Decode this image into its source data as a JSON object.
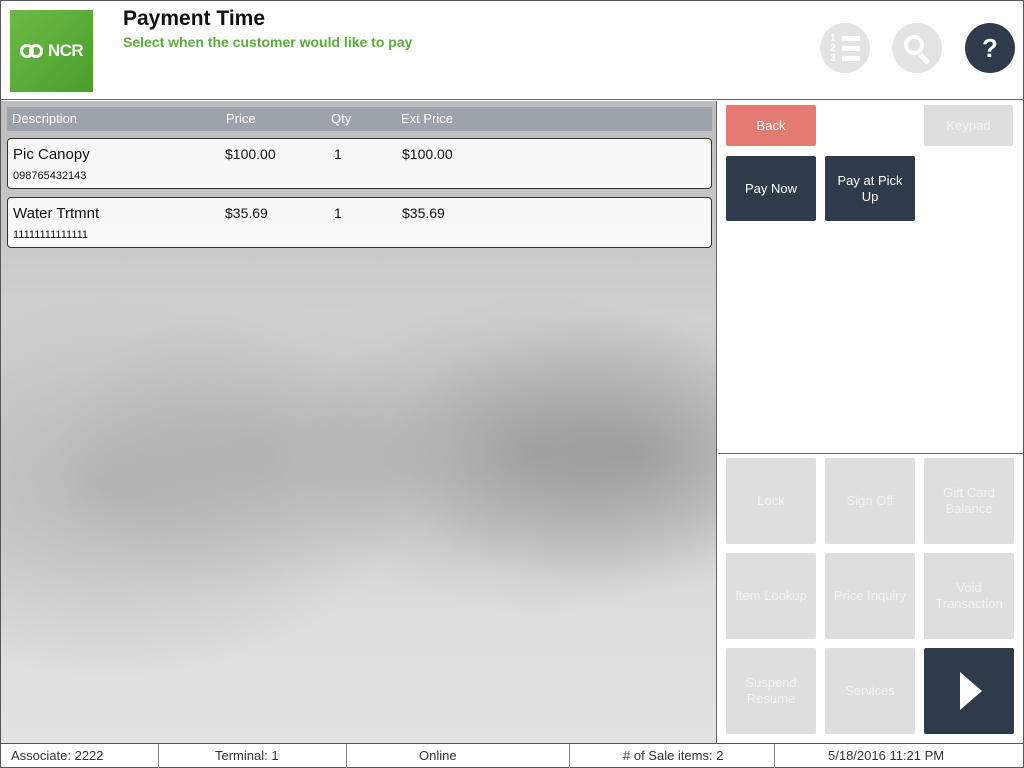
{
  "header": {
    "logo_text": "NCR",
    "title": "Payment Time",
    "subtitle": "Select when the customer would like to pay",
    "help_label": "?"
  },
  "table": {
    "columns": [
      "Description",
      "Price",
      "Qty",
      "Ext Price"
    ],
    "rows": [
      {
        "description": "Pic Canopy",
        "code": "098765432143",
        "price": "$100.00",
        "qty": "1",
        "ext_price": "$100.00"
      },
      {
        "description": "Water Trtmnt",
        "code": "11111111111111",
        "price": "$35.69",
        "qty": "1",
        "ext_price": "$35.69"
      }
    ]
  },
  "actions": {
    "back": "Back",
    "keypad": "Keypad",
    "pay_now": "Pay Now",
    "pay_at_pickup": "Pay at Pick Up"
  },
  "functions": {
    "lock": "Lock",
    "sign_off": "Sign Off",
    "gift_card_balance": "Gift Card Balance",
    "item_lookup": "Item Lookup",
    "price_inquiry": "Price Inquiry",
    "void_transaction": "Void Transaction",
    "suspend_resume": "Suspend Resume",
    "services": "Services"
  },
  "status": {
    "associate": "Associate: 2222",
    "terminal": "Terminal: 1",
    "connection": "Online",
    "sale_items": "# of Sale items: 2",
    "datetime": "5/18/2016 11:21 PM"
  },
  "colors": {
    "accent_green": "#5aaa3c",
    "dark_button": "#2f3b4a",
    "back_button": "#e57a70"
  }
}
